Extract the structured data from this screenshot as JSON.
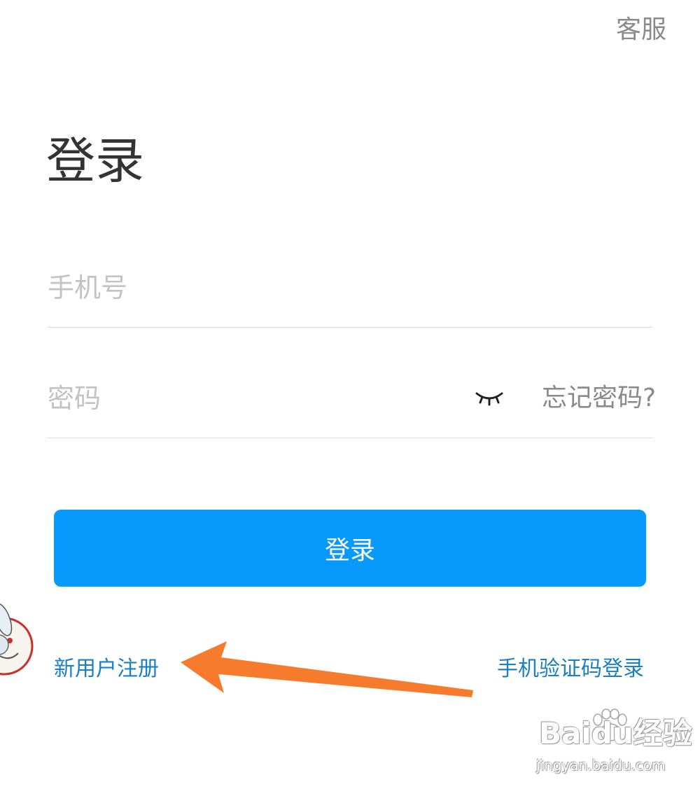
{
  "header": {
    "support_label": "客服"
  },
  "title": "登录",
  "form": {
    "phone_placeholder": "手机号",
    "password_placeholder": "密码",
    "eye_icon": "eye-closed",
    "forgot_label": "忘记密码?"
  },
  "login_button_label": "登录",
  "footer": {
    "register_label": "新用户注册",
    "sms_login_label": "手机验证码登录"
  },
  "overlay": {
    "arrow_color": "#f77b2c",
    "watermark_main": "Baidu经验",
    "watermark_sub": "jingyan.baidu.com"
  },
  "colors": {
    "primary": "#0799fb",
    "link": "#1b7fc4",
    "placeholder": "#c3c3c3",
    "muted": "#8a8a8a"
  }
}
